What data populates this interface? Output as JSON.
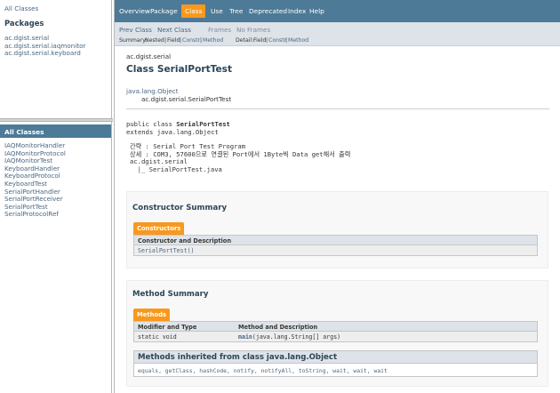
{
  "left_top": {
    "all_classes_link": "All Classes",
    "packages_heading": "Packages",
    "packages": [
      "ac.dgist.serial",
      "ac.dgist.serial.iaqmonitor",
      "ac.dgist.serial.keyboard"
    ]
  },
  "left_bottom": {
    "heading": "All Classes",
    "classes": [
      "IAQMonitorHandler",
      "IAQMonitorProtocol",
      "IAQMonitorTest",
      "KeyboardHandler",
      "KeyboardProtocol",
      "KeyboardTest",
      "SerialPortHandler",
      "SerialPortReceiver",
      "SerialPortTest",
      "SerialProtocolRef"
    ]
  },
  "topnav": {
    "overview": "Overview",
    "package": "Package",
    "class": "Class",
    "use": "Use",
    "tree": "Tree",
    "deprecated": "Deprecated",
    "index": "Index",
    "help": "Help"
  },
  "subnav": {
    "prev_class": "Prev Class",
    "next_class": "Next Class",
    "frames": "Frames",
    "no_frames": "No Frames",
    "summary_label": "Summary:",
    "summary_nested": "Nested",
    "summary_field": "Field",
    "summary_constr": "Constr",
    "summary_method": "Method",
    "detail_label": "Detail:",
    "detail_field": "Field",
    "detail_constr": "Constr",
    "detail_method": "Method"
  },
  "header": {
    "package": "ac.dgist.serial",
    "title": "Class SerialPortTest",
    "inherit_parent": "java.lang.Object",
    "inherit_child": "ac.dgist.serial.SerialPortTest"
  },
  "declaration": {
    "prefix": "public class ",
    "name": "SerialPortTest",
    "extends": "extends java.lang.Object"
  },
  "description": {
    "line1": "간략 : Serial Port Test Program",
    "line2": "상세 : COM3, 57600으로 연결된 Port에서 1Byte씩 Data get해서 출력",
    "line3": "ac.dgist.serial",
    "line4": "  |_ SerialPortTest.java"
  },
  "constructor_summary": {
    "title": "Constructor Summary",
    "caption": "Constructors",
    "col_header": "Constructor and Description",
    "rows": [
      {
        "signature": "SerialPortTest()"
      }
    ]
  },
  "method_summary": {
    "title": "Method Summary",
    "caption": "Methods",
    "col_modifier": "Modifier and Type",
    "col_method": "Method and Description",
    "rows": [
      {
        "modifier": "static void",
        "name": "main",
        "params": "(java.lang.String[] args)"
      }
    ]
  },
  "inherited": {
    "title": "Methods inherited from class java.lang.Object",
    "methods": "equals, getClass, hashCode, notify, notifyAll, toString, wait, wait, wait"
  },
  "colors": {
    "nav_bar": "#4d7a97",
    "active_tab": "#f8981d",
    "subnav": "#dee3e9",
    "link": "#4a6782",
    "heading": "#2c4557"
  }
}
